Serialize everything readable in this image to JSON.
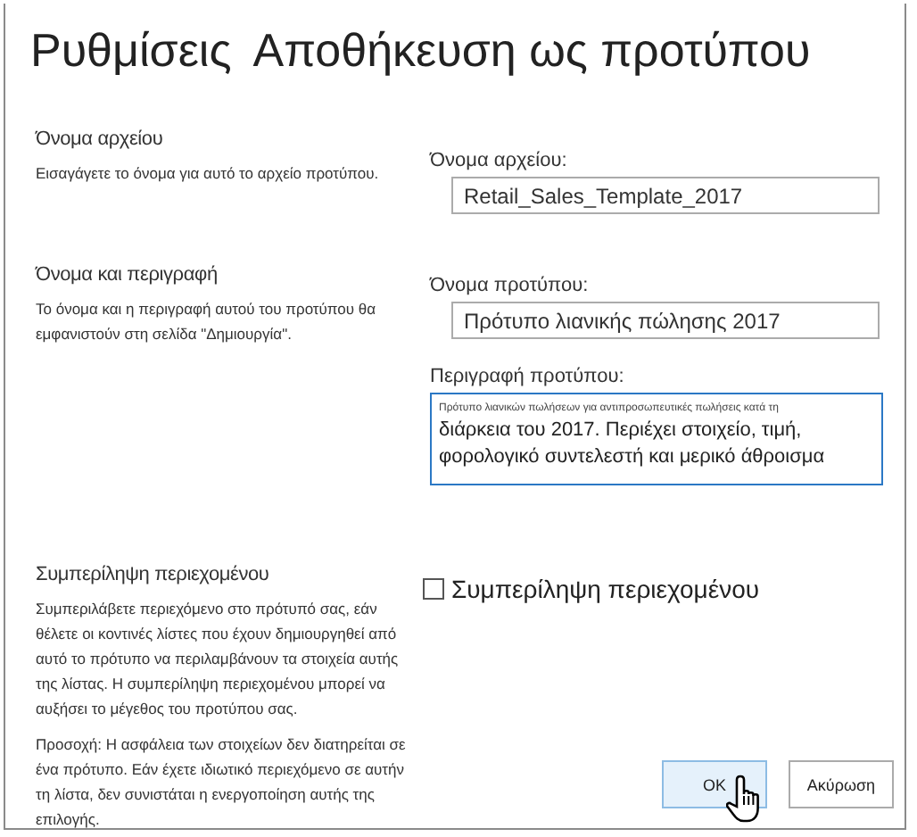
{
  "title": [
    "Ρυθμίσεις",
    "Αποθήκευση ως προτύπου"
  ],
  "sections": [
    {
      "heading": "Όνομα αρχείου",
      "description": [
        "Εισαγάγετε το όνομα για αυτό το αρχείο προτύπου."
      ],
      "controls": [
        {
          "kind": "input",
          "label": "Όνομα αρχείου:",
          "value": "Retail_Sales_Template_2017"
        }
      ]
    },
    {
      "heading": "Όνομα και περιγραφή",
      "description": [
        "Το όνομα και η περιγραφή αυτού του προτύπου θα εμφανιστούν στη σελίδα \"Δημιουργία\"."
      ],
      "controls": [
        {
          "kind": "input",
          "label": "Όνομα προτύπου:",
          "value": "Πρότυπο λιανικής πώλησης 2017"
        },
        {
          "kind": "textarea",
          "label": "Περιγραφή προτύπου:",
          "value_first_line": "Πρότυπο λιανικών πωλήσεων για αντιπροσωπευτικές πωλήσεις κατά τη",
          "value": "διάρκεια του 2017. Περιέχει στοιχείο, τιμή, φορολογικό συντελεστή και μερικό άθροισμα"
        }
      ]
    },
    {
      "heading": "Συμπερίληψη περιεχομένου",
      "description": [
        "Συμπεριλάβετε περιεχόμενο στο πρότυπό σας, εάν θέλετε οι κοντινές λίστες που έχουν δημιουργηθεί από αυτό το πρότυπο να περιλαμβάνουν τα στοιχεία αυτής της λίστας. Η συμπερίληψη περιεχομένου μπορεί να αυξήσει το μέγεθος του προτύπου σας.",
        "Προσοχή: Η ασφάλεια των στοιχείων δεν διατηρείται σε ένα πρότυπο. Εάν έχετε ιδιωτικό περιεχόμενο σε αυτήν τη λίστα, δεν συνιστάται η ενεργοποίηση αυτής της επιλογής."
      ],
      "controls": [
        {
          "kind": "checkbox",
          "label": "Συμπερίληψη περιεχομένου",
          "checked": false
        }
      ]
    }
  ],
  "buttons": [
    {
      "label": "OK",
      "selected": true
    },
    {
      "label": "Ακύρωση",
      "selected": false
    }
  ]
}
